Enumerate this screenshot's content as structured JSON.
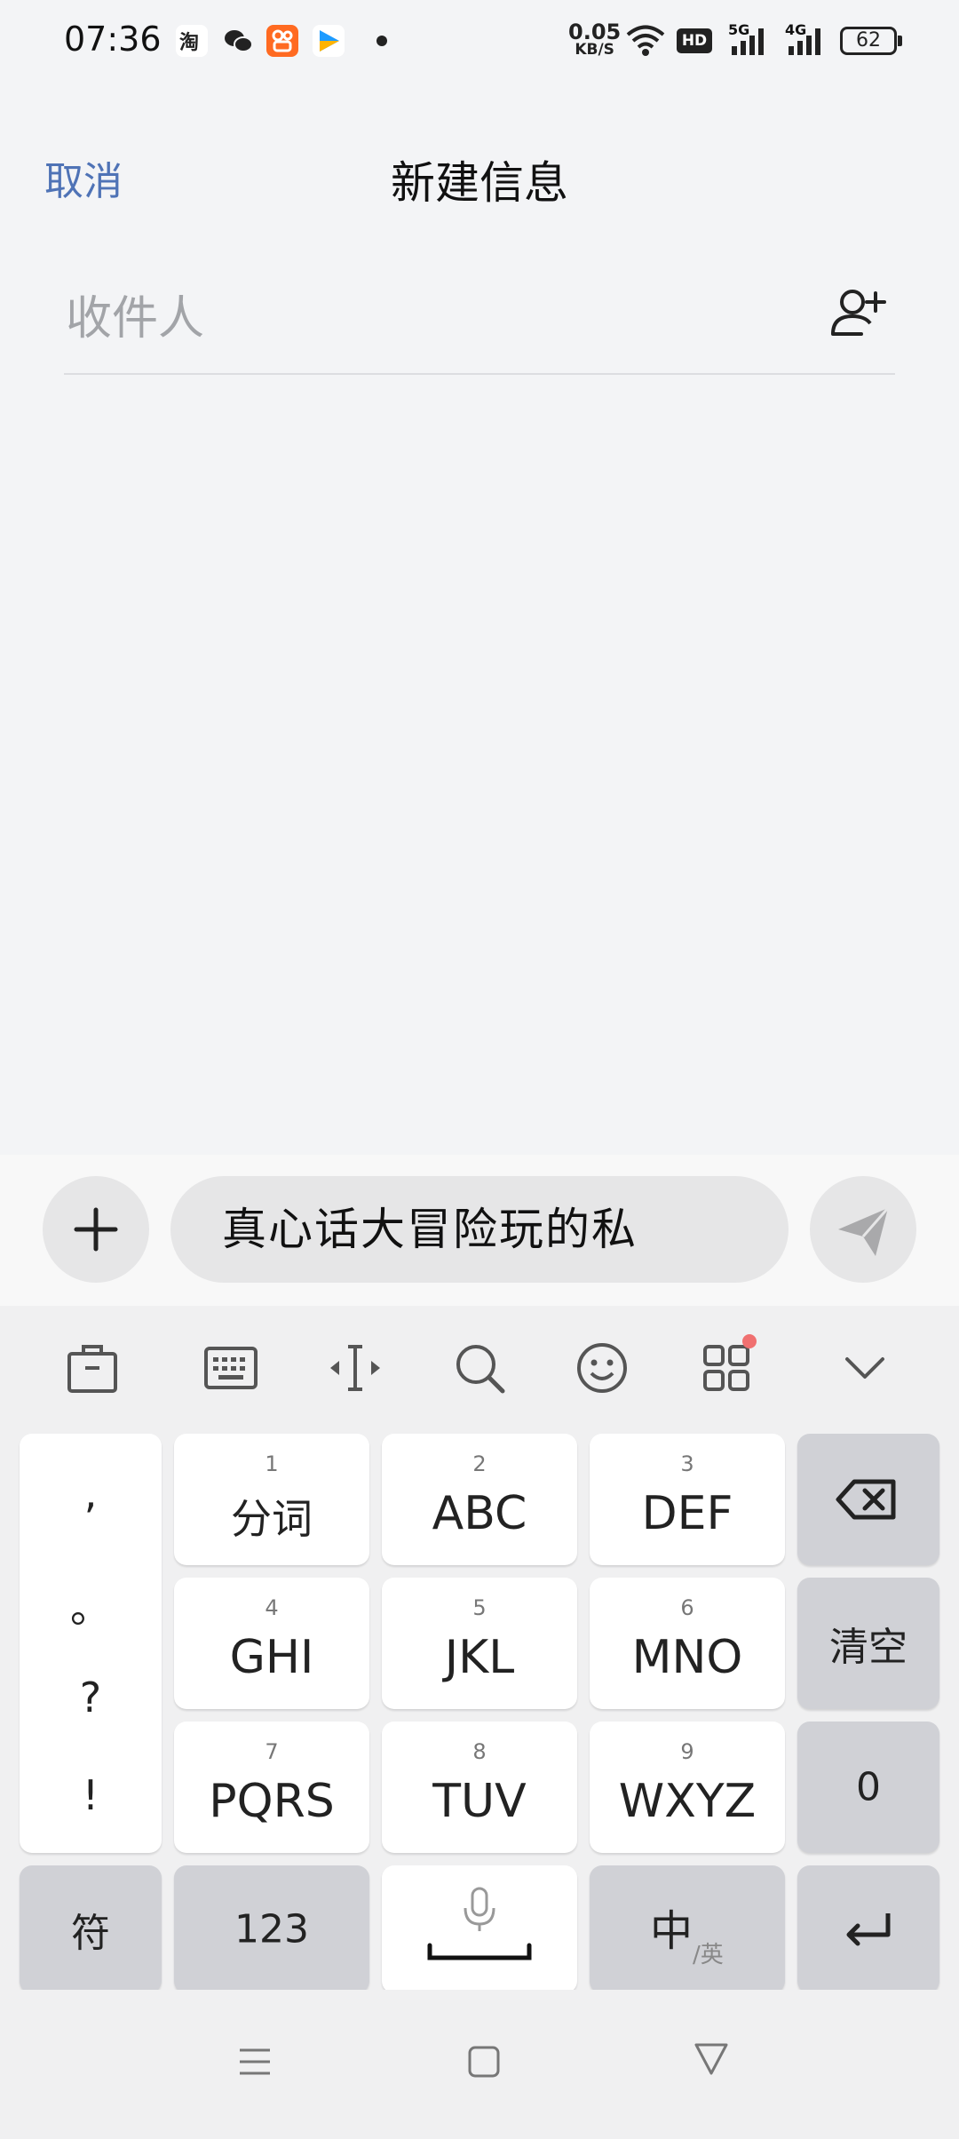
{
  "status_bar": {
    "time": "07:36",
    "speed_value": "0.05",
    "speed_unit": "KB/S",
    "hd_badge": "HD",
    "net_5g": "5G",
    "net_4g": "4G",
    "battery": "62",
    "icons": [
      "taobao-icon",
      "wechat-icon",
      "kuaishou-icon",
      "video-app-icon",
      "notification-dot",
      "wifi-icon",
      "signal-icon",
      "battery-icon"
    ]
  },
  "header": {
    "cancel_label": "取消",
    "title": "新建信息"
  },
  "recipient": {
    "placeholder": "收件人"
  },
  "compose": {
    "message_text": "真心话大冒险玩的私"
  },
  "keyboard": {
    "punctuation": [
      ",",
      "。",
      "?",
      "!"
    ],
    "keys": [
      {
        "num": "1",
        "label": "分词"
      },
      {
        "num": "2",
        "label": "ABC"
      },
      {
        "num": "3",
        "label": "DEF"
      },
      {
        "num": "4",
        "label": "GHI"
      },
      {
        "num": "5",
        "label": "JKL"
      },
      {
        "num": "6",
        "label": "MNO"
      },
      {
        "num": "7",
        "label": "PQRS"
      },
      {
        "num": "8",
        "label": "TUV"
      },
      {
        "num": "9",
        "label": "WXYZ"
      }
    ],
    "clear_label": "清空",
    "zero_label": "0",
    "symbol_label": "符",
    "num_label": "123",
    "lang_main": "中",
    "lang_sub": "/英"
  },
  "colors": {
    "accent": "#4f73b6",
    "background": "#f3f4f6",
    "dark_key": "#d0d1d6",
    "badge_red": "#f07070"
  }
}
